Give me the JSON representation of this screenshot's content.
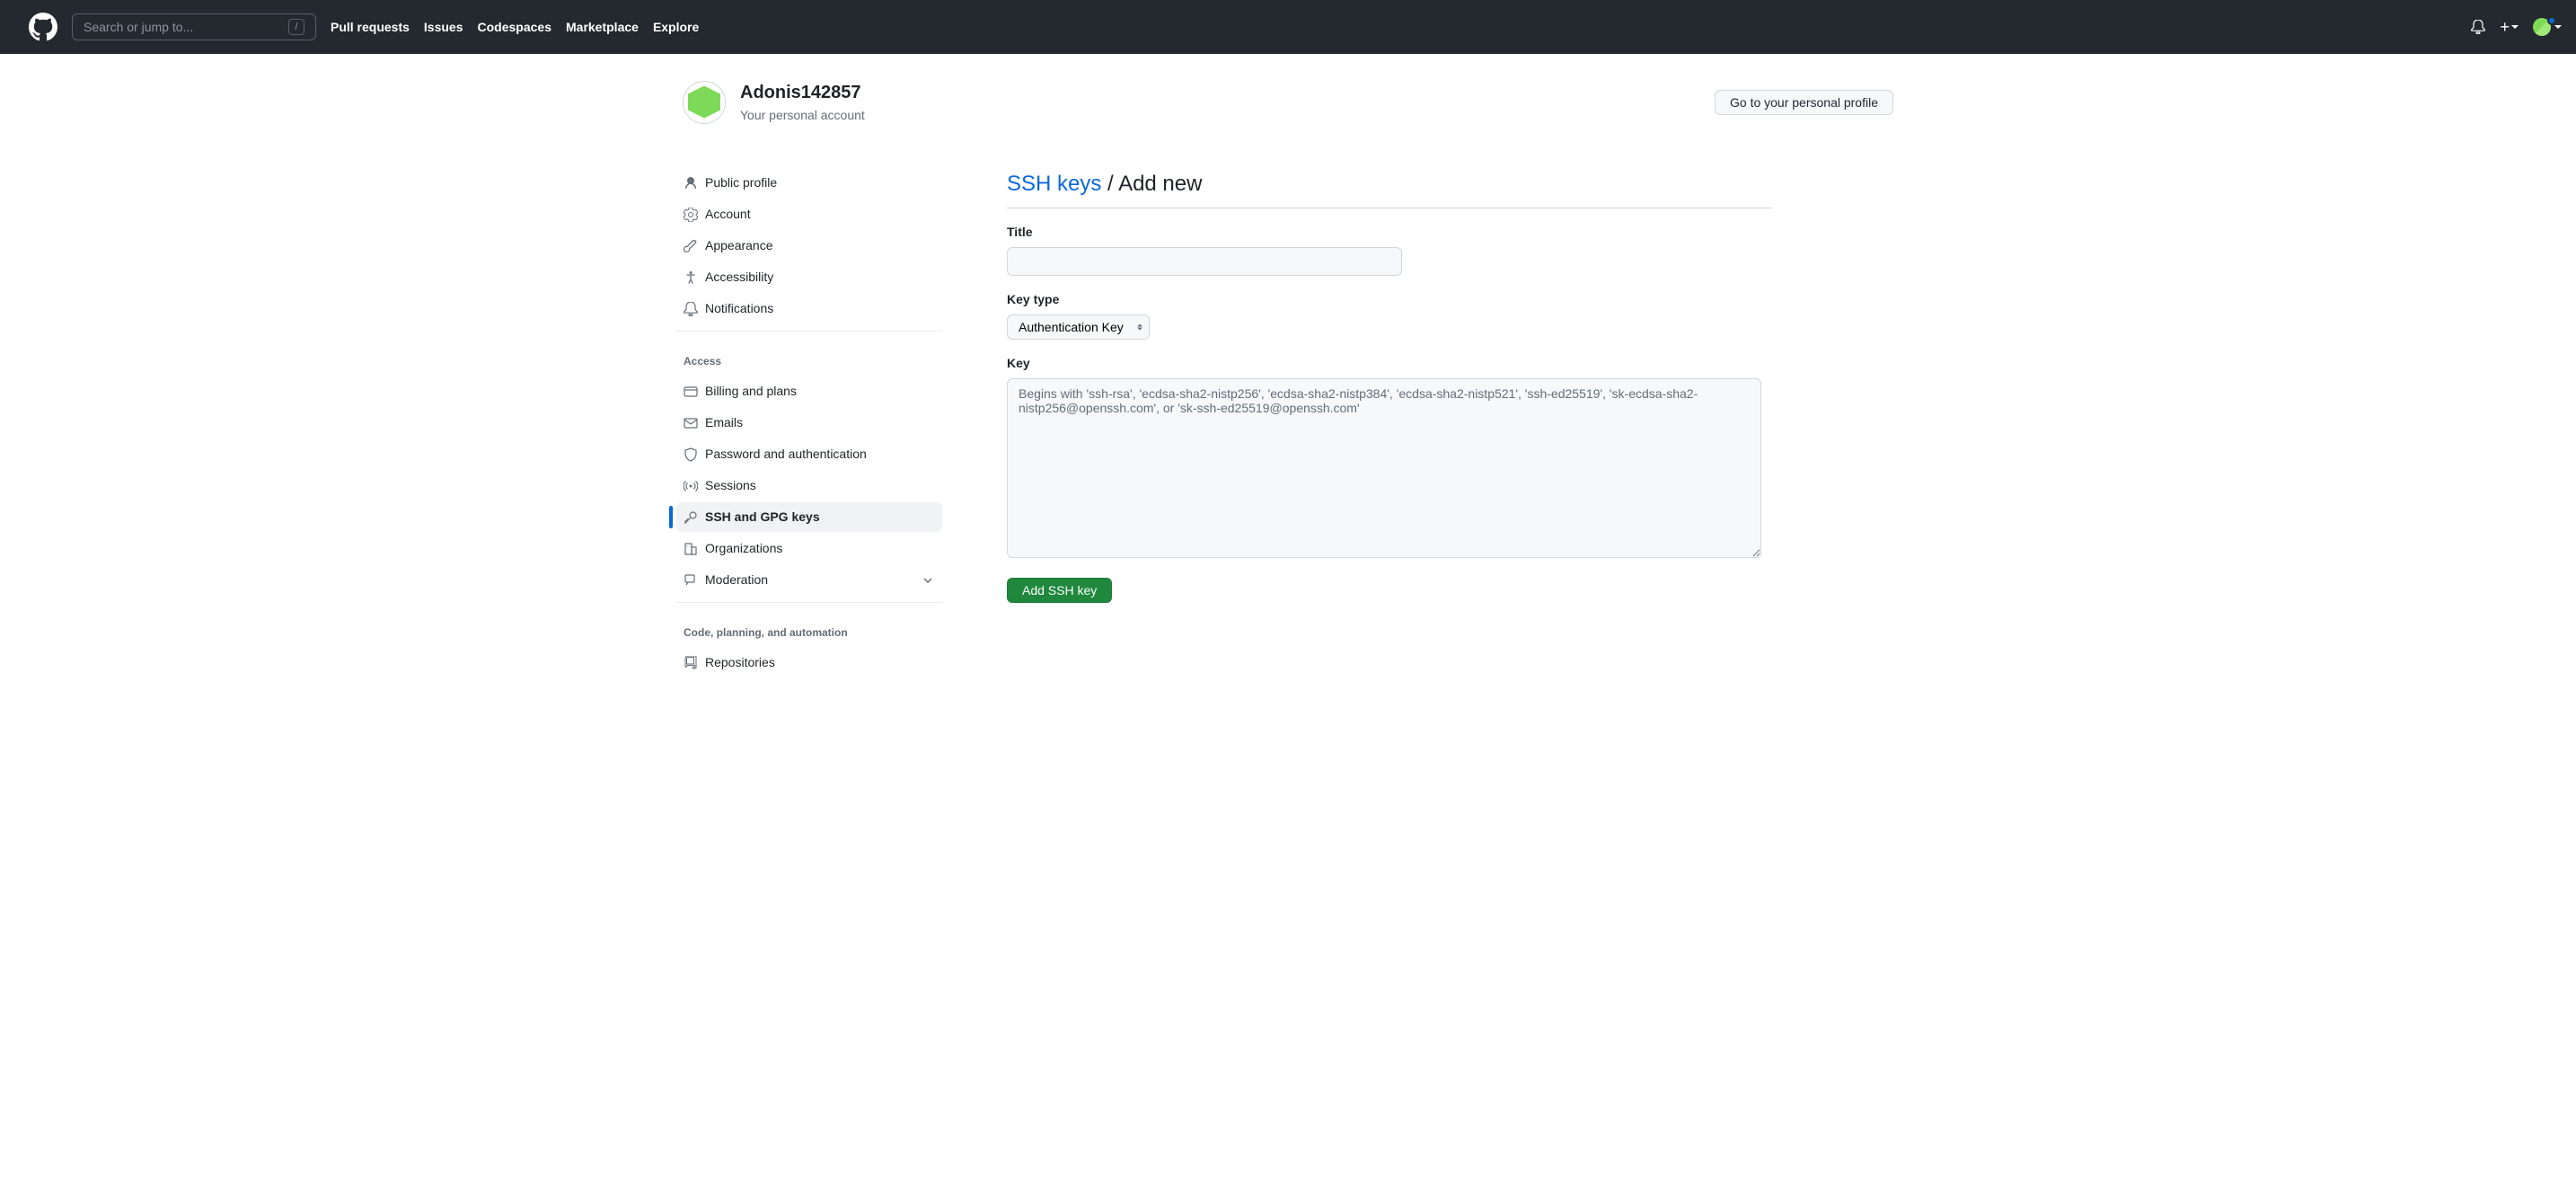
{
  "header": {
    "search_placeholder": "Search or jump to...",
    "slash": "/",
    "nav": [
      "Pull requests",
      "Issues",
      "Codespaces",
      "Marketplace",
      "Explore"
    ]
  },
  "account": {
    "username": "Adonis142857",
    "subtitle": "Your personal account",
    "profile_button": "Go to your personal profile"
  },
  "sidebar": {
    "group1": [
      {
        "icon": "person",
        "label": "Public profile"
      },
      {
        "icon": "gear",
        "label": "Account"
      },
      {
        "icon": "paintbrush",
        "label": "Appearance"
      },
      {
        "icon": "accessibility",
        "label": "Accessibility"
      },
      {
        "icon": "bell",
        "label": "Notifications"
      }
    ],
    "heading_access": "Access",
    "group_access": [
      {
        "icon": "credit-card",
        "label": "Billing and plans"
      },
      {
        "icon": "mail",
        "label": "Emails"
      },
      {
        "icon": "shield-lock",
        "label": "Password and authentication"
      },
      {
        "icon": "broadcast",
        "label": "Sessions"
      },
      {
        "icon": "key",
        "label": "SSH and GPG keys",
        "active": true
      },
      {
        "icon": "organization",
        "label": "Organizations"
      },
      {
        "icon": "report",
        "label": "Moderation",
        "expandable": true
      }
    ],
    "heading_code": "Code, planning, and automation",
    "group_code": [
      {
        "icon": "repo",
        "label": "Repositories"
      }
    ]
  },
  "main": {
    "breadcrumb_link": "SSH keys",
    "breadcrumb_sep": " / ",
    "breadcrumb_current": "Add new",
    "title_label": "Title",
    "keytype_label": "Key type",
    "keytype_value": "Authentication Key",
    "key_label": "Key",
    "key_placeholder": "Begins with 'ssh-rsa', 'ecdsa-sha2-nistp256', 'ecdsa-sha2-nistp384', 'ecdsa-sha2-nistp521', 'ssh-ed25519', 'sk-ecdsa-sha2-nistp256@openssh.com', or 'sk-ssh-ed25519@openssh.com'",
    "submit_label": "Add SSH key"
  }
}
